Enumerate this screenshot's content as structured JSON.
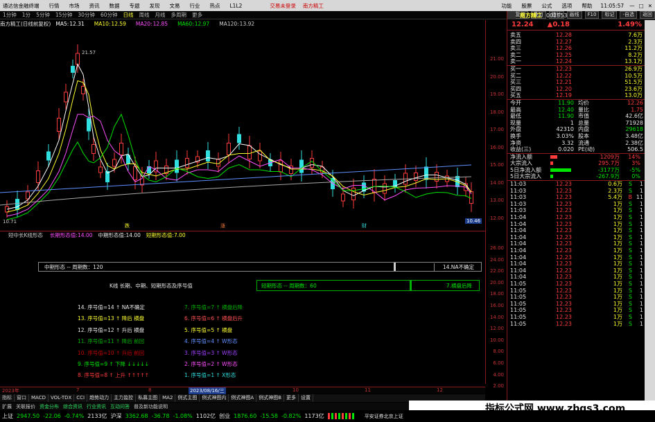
{
  "window": {
    "title": "通达信金融终端",
    "menus": [
      "行情",
      "市场",
      "资讯",
      "数据",
      "专题",
      "发现",
      "文易",
      "行业",
      "热点",
      "L1L2"
    ],
    "center_red": [
      "交易未登录",
      "南方精工"
    ],
    "right_menus": [
      "功能",
      "股票",
      "公式",
      "选项",
      "帮助"
    ],
    "clock": "11:05:57"
  },
  "periods": [
    "1分钟",
    "1分",
    "5分钟",
    "15分钟",
    "30分钟",
    "60分钟",
    "日线",
    "周线",
    "月线",
    "多周期",
    "更多"
  ],
  "period_active": "日线",
  "toolbar_buttons": [
    "复权",
    "叠加",
    "统计",
    "画线",
    "F10",
    "标记",
    "-自选",
    "返回"
  ],
  "chart_header": {
    "stock": "南方精工(日线前复权)",
    "ma": [
      {
        "label": "MA5:",
        "value": "12.31",
        "color": "#ffffff"
      },
      {
        "label": "MA10:",
        "value": "12.59",
        "color": "#ffff30"
      },
      {
        "label": "MA20:",
        "value": "12.85",
        "color": "#ff50ff"
      },
      {
        "label": "MA60:",
        "value": "12.97",
        "color": "#00e600"
      },
      {
        "label": "MA120:",
        "value": "13.92",
        "color": "#cccccc"
      }
    ]
  },
  "chart_labels": {
    "high": "21.57",
    "low": "10.71",
    "bottom_markers": [
      "跌",
      "涨",
      "财"
    ],
    "price_tag": "10.46"
  },
  "price_axis": [
    "21.00",
    "20.00",
    "19.00",
    "18.00",
    "17.00",
    "16.00",
    "15.00",
    "14.00",
    "13.00",
    "12.00"
  ],
  "indicator_axis": [
    "26.00",
    "24.00",
    "22.00",
    "20.00",
    "18.00",
    "16.00",
    "14.00",
    "12.00",
    "10.00",
    "8.00",
    "6.00",
    "4.00",
    "2.00"
  ],
  "indicator_header": {
    "name": "短中长K线形态",
    "items": [
      "长期形态值:14.00",
      "中期形态值:14.00",
      "短期形态值:7.00"
    ]
  },
  "indicator": {
    "mid_bar": {
      "left": "中期形态 -- 周期数：120",
      "right": "14.NA不确定"
    },
    "title": "K线 长期、中期、短期形态及序号值",
    "short_bar": {
      "left": "短期形态 -- 周期数：60",
      "right": "7.横盘后降"
    },
    "list_left": [
      {
        "text": "14. 序号值=14 ↑ NA不确定",
        "color": "#e8e8e8"
      },
      {
        "text": "13. 序号值=13 ↑ 降后 横盘",
        "color": "#ffff30"
      },
      {
        "text": "12. 序号值=12 ↑ 升后 横盘",
        "color": "#e8e8e8"
      },
      {
        "text": "11. 序号值=11 ↑ 降后 前回",
        "color": "#00b000"
      },
      {
        "text": "10. 序号值=10 ↑ 升后 前回",
        "color": "#c00000"
      },
      {
        "text": "9. 序号值=9 ↑ 下降 ↓↓↓↓↓",
        "color": "#00e600"
      },
      {
        "text": "8. 序号值=8 ↑ 上升 ↑↑↑↑↑",
        "color": "#ff3c3c"
      }
    ],
    "list_right": [
      {
        "text": "7. 序号值=7 ↑ 横盘后降",
        "color": "#00b000"
      },
      {
        "text": "6. 序号值=6 ↑ 横盘后升",
        "color": "#ff5050"
      },
      {
        "text": "5. 序号值=5 ↑ 横盘",
        "color": "#ffff30"
      },
      {
        "text": "4. 序号值=4 ↑ W形态",
        "color": "#6090ff"
      },
      {
        "text": "3. 序号值=3 ↑ W形态",
        "color": "#a040ff"
      },
      {
        "text": "2. 序号值=2 ↑ W形态",
        "color": "#ff50ff"
      },
      {
        "text": "1. 序号值=1 ↑ X形态",
        "color": "#30e0e0"
      }
    ]
  },
  "date_axis": {
    "left": "2023年",
    "labels": [
      "7",
      "8",
      "9",
      "10",
      "11",
      "12"
    ],
    "highlight": "2023/08/16/三"
  },
  "bottom_tabs": [
    "指标",
    "窗口",
    "MACD",
    "VOL-TDX",
    "CCI",
    "趋势动力",
    "主力监控",
    "私募主图",
    "MA2",
    "例式主图",
    "例式神图内",
    "例式神图A",
    "例式神图B",
    "更多",
    "设置"
  ],
  "bottom_tabs2": [
    "扩展",
    "关联报价",
    "资金分布",
    "综合资讯",
    "行业资讯",
    "互动问答",
    "普及新功能说明"
  ],
  "status": {
    "sh": {
      "name": "上证",
      "val": "2947.50",
      "chg": "-22.06",
      "pct": "-0.74%",
      "amt": "2133亿"
    },
    "sz": {
      "name": "沪深",
      "val": "3362.68",
      "chg": "-36.78",
      "pct": "-1.08%",
      "amt": "1102亿"
    },
    "cy": {
      "name": "创业",
      "val": "1876.60",
      "chg": "-15.58",
      "pct": "-0.82%",
      "amt": "1173亿"
    },
    "broker": "平安证券北京上证"
  },
  "footer_logo": "指标公式网  www.zbgs3.com",
  "quote": {
    "name": "南方精工",
    "code": "002553",
    "price": "12.24",
    "chg": "▲0.18",
    "pct": "1.49%",
    "sells": [
      {
        "k": "卖五",
        "p": "12.28",
        "v": "7.6万"
      },
      {
        "k": "卖四",
        "p": "12.27",
        "v": "2.3万"
      },
      {
        "k": "卖三",
        "p": "12.26",
        "v": "11.2万"
      },
      {
        "k": "卖二",
        "p": "12.25",
        "v": "8.2万"
      },
      {
        "k": "卖一",
        "p": "12.24",
        "v": "13.1万"
      }
    ],
    "buys": [
      {
        "k": "买一",
        "p": "12.23",
        "v": "26.9万"
      },
      {
        "k": "买二",
        "p": "12.22",
        "v": "10.5万"
      },
      {
        "k": "买三",
        "p": "12.21",
        "v": "51.5万"
      },
      {
        "k": "买四",
        "p": "12.20",
        "v": "23.6万"
      },
      {
        "k": "买五",
        "p": "12.19",
        "v": "13.0万"
      }
    ],
    "stats": [
      [
        "今开",
        "11.90",
        "均价",
        "12.26"
      ],
      [
        "最高",
        "12.40",
        "量比",
        "1.75"
      ],
      [
        "最低",
        "11.90",
        "市值",
        "42.6亿"
      ],
      [
        "现量",
        "1",
        "总量",
        "71928"
      ],
      [
        "外盘",
        "42310",
        "内盘",
        "29618"
      ],
      [
        "换手",
        "3.03%",
        "股本",
        "3.48亿"
      ],
      [
        "净资",
        "3.32",
        "流通",
        "2.38亿"
      ],
      [
        "收益(三)",
        "0.020",
        "PE(动)",
        "506.5"
      ]
    ],
    "flows": [
      {
        "k": "净流入额",
        "v": "1209万",
        "p": "14%",
        "c": "#ff3c3c"
      },
      {
        "k": "大宗流入",
        "v": "295.7万",
        "p": "3%",
        "c": "#ff3c3c"
      },
      {
        "k": "5日净流入额",
        "v": "-3177万",
        "p": "-5%",
        "c": "#00e600"
      },
      {
        "k": "5日大宗流入",
        "v": "-267.9万",
        "p": "0%",
        "c": "#00e600"
      }
    ],
    "ticks": [
      [
        "11:03",
        "12.23",
        "0.6万",
        "S",
        "1"
      ],
      [
        "11:03",
        "12.23",
        "2.3万",
        "S",
        "1"
      ],
      [
        "11:03",
        "12.23",
        "5.4万",
        "B",
        "11"
      ],
      [
        "11:03",
        "12.23",
        "1万",
        "S",
        "1"
      ],
      [
        "11:03",
        "12.23",
        "1万",
        "S",
        "1"
      ],
      [
        "11:04",
        "12.23",
        "1万",
        "S",
        "1"
      ],
      [
        "11:04",
        "12.23",
        "1万",
        "S",
        "1"
      ],
      [
        "11:04",
        "12.23",
        "1万",
        "S",
        "1"
      ],
      [
        "11:04",
        "12.23",
        "1万",
        "S",
        "1"
      ],
      [
        "11:04",
        "12.23",
        "1万",
        "S",
        "1"
      ],
      [
        "11:04",
        "12.23",
        "1万",
        "S",
        "1"
      ],
      [
        "11:04",
        "12.23",
        "1万",
        "S",
        "1"
      ],
      [
        "11:04",
        "12.23",
        "1万",
        "S",
        "1"
      ],
      [
        "11:04",
        "12.23",
        "1万",
        "S",
        "1"
      ],
      [
        "11:04",
        "12.23",
        "1万",
        "S",
        "1"
      ],
      [
        "11:05",
        "12.23",
        "1万",
        "S",
        "1"
      ],
      [
        "11:05",
        "12.23",
        "1万",
        "S",
        "1"
      ],
      [
        "11:05",
        "12.23",
        "1万",
        "S",
        "1"
      ],
      [
        "11:05",
        "12.23",
        "1万",
        "S",
        "1"
      ],
      [
        "11:05",
        "12.23",
        "1万",
        "S",
        "1"
      ],
      [
        "11:05",
        "12.23",
        "1万",
        "S",
        "1"
      ],
      [
        "11:05",
        "12.23",
        "1万",
        "S",
        "1"
      ]
    ]
  }
}
